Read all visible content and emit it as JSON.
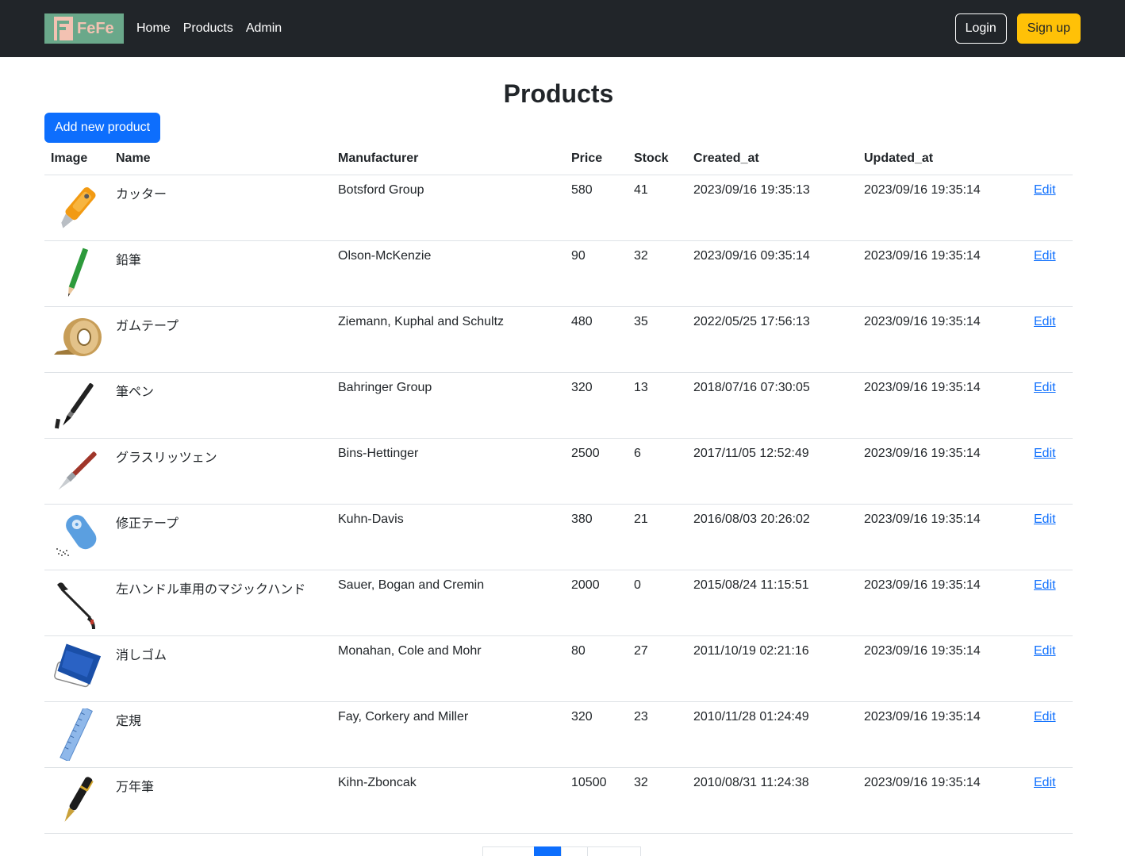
{
  "nav": {
    "brand_text": "FeFe",
    "links": [
      "Home",
      "Products",
      "Admin"
    ],
    "login_label": "Login",
    "signup_label": "Sign up"
  },
  "page": {
    "title": "Products",
    "add_button_label": "Add new product"
  },
  "table": {
    "headers": [
      "Image",
      "Name",
      "Manufacturer",
      "Price",
      "Stock",
      "Created_at",
      "Updated_at",
      ""
    ],
    "edit_label": "Edit",
    "rows": [
      {
        "icon": "cutter-knife-icon",
        "name": "カッター",
        "manufacturer": "Botsford Group",
        "price": "580",
        "stock": "41",
        "created_at": "2023/09/16 19:35:13",
        "updated_at": "2023/09/16 19:35:14"
      },
      {
        "icon": "pencil-icon",
        "name": "鉛筆",
        "manufacturer": "Olson-McKenzie",
        "price": "90",
        "stock": "32",
        "created_at": "2023/09/16 09:35:14",
        "updated_at": "2023/09/16 19:35:14"
      },
      {
        "icon": "packing-tape-icon",
        "name": "ガムテープ",
        "manufacturer": "Ziemann, Kuphal and Schultz",
        "price": "480",
        "stock": "35",
        "created_at": "2022/05/25 17:56:13",
        "updated_at": "2023/09/16 19:35:14"
      },
      {
        "icon": "brush-pen-icon",
        "name": "筆ペン",
        "manufacturer": "Bahringer Group",
        "price": "320",
        "stock": "13",
        "created_at": "2018/07/16 07:30:05",
        "updated_at": "2023/09/16 19:35:14"
      },
      {
        "icon": "glass-pen-icon",
        "name": "グラスリッツェン",
        "manufacturer": "Bins-Hettinger",
        "price": "2500",
        "stock": "6",
        "created_at": "2017/11/05 12:52:49",
        "updated_at": "2023/09/16 19:35:14"
      },
      {
        "icon": "correction-tape-icon",
        "name": "修正テープ",
        "manufacturer": "Kuhn-Davis",
        "price": "380",
        "stock": "21",
        "created_at": "2016/08/03 20:26:02",
        "updated_at": "2023/09/16 19:35:14"
      },
      {
        "icon": "grabber-tool-icon",
        "name": "左ハンドル車用のマジックハンド",
        "manufacturer": "Sauer, Bogan and Cremin",
        "price": "2000",
        "stock": "0",
        "created_at": "2015/08/24 11:15:51",
        "updated_at": "2023/09/16 19:35:14"
      },
      {
        "icon": "eraser-icon",
        "name": "消しゴム",
        "manufacturer": "Monahan, Cole and Mohr",
        "price": "80",
        "stock": "27",
        "created_at": "2011/10/19 02:21:16",
        "updated_at": "2023/09/16 19:35:14"
      },
      {
        "icon": "ruler-icon",
        "name": "定規",
        "manufacturer": "Fay, Corkery and Miller",
        "price": "320",
        "stock": "23",
        "created_at": "2010/11/28 01:24:49",
        "updated_at": "2023/09/16 19:35:14"
      },
      {
        "icon": "fountain-pen-icon",
        "name": "万年筆",
        "manufacturer": "Kihn-Zboncak",
        "price": "10500",
        "stock": "32",
        "created_at": "2010/08/31 11:24:38",
        "updated_at": "2023/09/16 19:35:14"
      }
    ]
  },
  "colors": {
    "navbar": "#212529",
    "primary": "#0d6efd",
    "warning": "#ffc107",
    "brand_bg": "#6aa88a",
    "brand_fg": "#f3c2b2"
  }
}
